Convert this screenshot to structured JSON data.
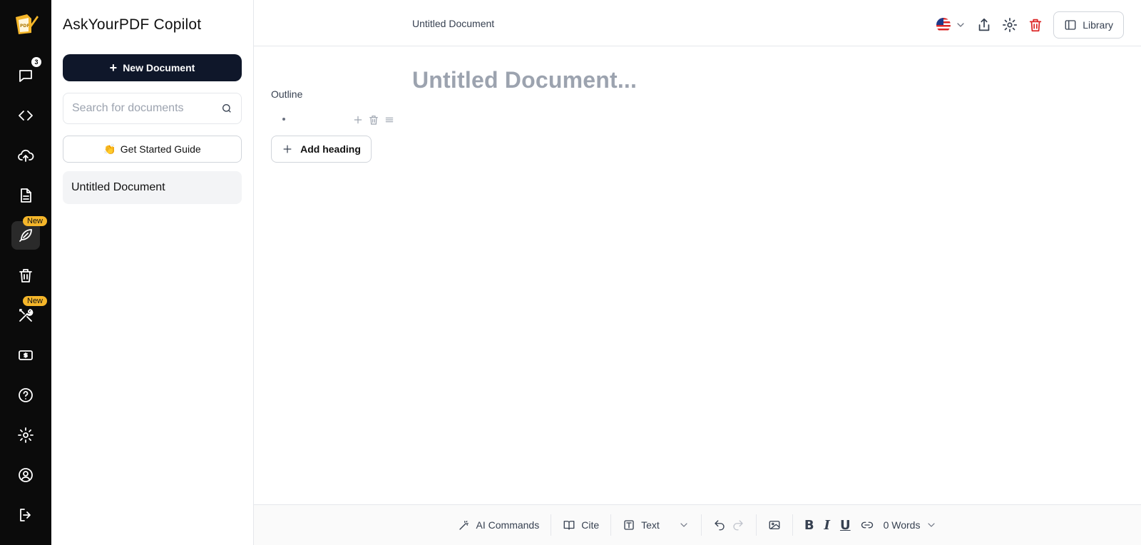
{
  "app": {
    "name": "AskYourPDF Copilot"
  },
  "rail": {
    "chat_count": "3",
    "badges": {
      "write": "New",
      "tools": "New"
    }
  },
  "docs_panel": {
    "new_document_label": "New Document",
    "search_placeholder": "Search for documents",
    "guide_label": "Get Started Guide",
    "guide_emoji": "👏",
    "documents": [
      {
        "title": "Untitled Document"
      }
    ]
  },
  "topbar": {
    "document_title": "Untitled Document",
    "language_flag": "us-flag-icon",
    "library_label": "Library"
  },
  "editor": {
    "outline_label": "Outline",
    "add_heading_label": "Add heading",
    "heading_placeholder": "Untitled Document..."
  },
  "toolbar": {
    "ai_commands_label": "AI Commands",
    "cite_label": "Cite",
    "text_style_label": "Text",
    "bold_label": "B",
    "italic_label": "I",
    "underline_label": "U",
    "word_count_label": "0 Words"
  },
  "colors": {
    "rail_bg": "#0b0b0b",
    "badge": "#f5b62a",
    "primary_button": "#0f172a",
    "delete_red": "#dc2626",
    "placeholder_gray": "#9ca3af"
  }
}
